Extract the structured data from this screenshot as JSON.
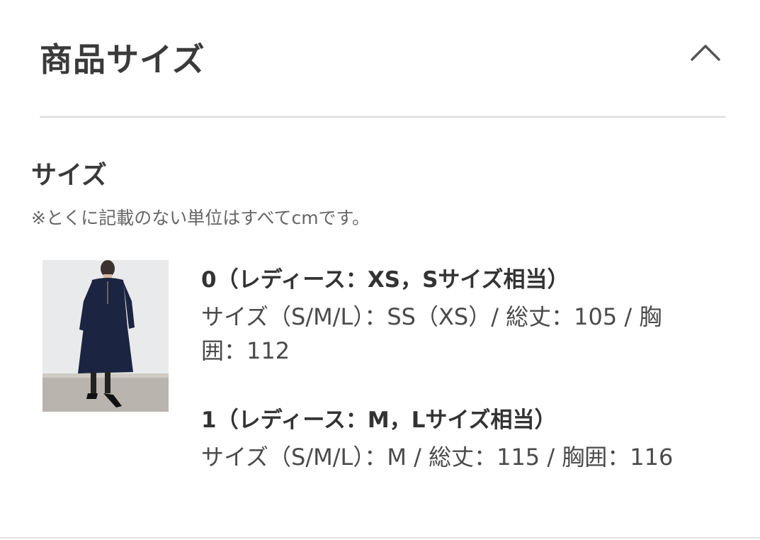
{
  "header": {
    "title": "商品サイズ",
    "toggle_icon": "chevron-up-icon"
  },
  "section": {
    "title": "サイズ",
    "note": "※とくに記載のない単位はすべてcmです。"
  },
  "thumbnail": {
    "icon": "product-photo"
  },
  "sizes": [
    {
      "heading": "0（レディース：XS，Sサイズ相当）",
      "detail": "サイズ（S/M/L）：SS（XS）/ 総丈：105 / 胸囲：112"
    },
    {
      "heading": "1（レディース：M，Lサイズ相当）",
      "detail": "サイズ（S/M/L）：M / 総丈：115 / 胸囲：116"
    }
  ],
  "colors": {
    "text": "#3a3a3a",
    "muted": "#666666",
    "divider": "#d9d9d9",
    "dress": "#1b2440"
  }
}
